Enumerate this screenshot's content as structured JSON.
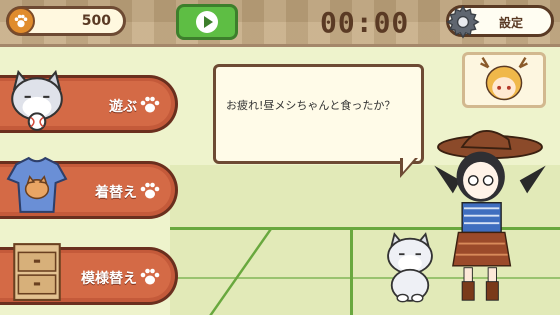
{
  "header": {
    "coins": "500",
    "timer": "00:00",
    "settings_label": "設定"
  },
  "menu": {
    "items": [
      {
        "label": "遊ぶ",
        "icon": "cat-face-with-ball-icon"
      },
      {
        "label": "着替え",
        "icon": "tshirt-icon"
      },
      {
        "label": "模様替え",
        "icon": "drawer-cabinet-icon"
      }
    ]
  },
  "dialog": {
    "text": "お疲れ!昼メシちゃんと食ったか？"
  },
  "colors": {
    "menu_button": "#d46a46",
    "play_button": "#5ebe44",
    "topbar": "#c9b08a",
    "text_brown": "#5a3a24"
  }
}
